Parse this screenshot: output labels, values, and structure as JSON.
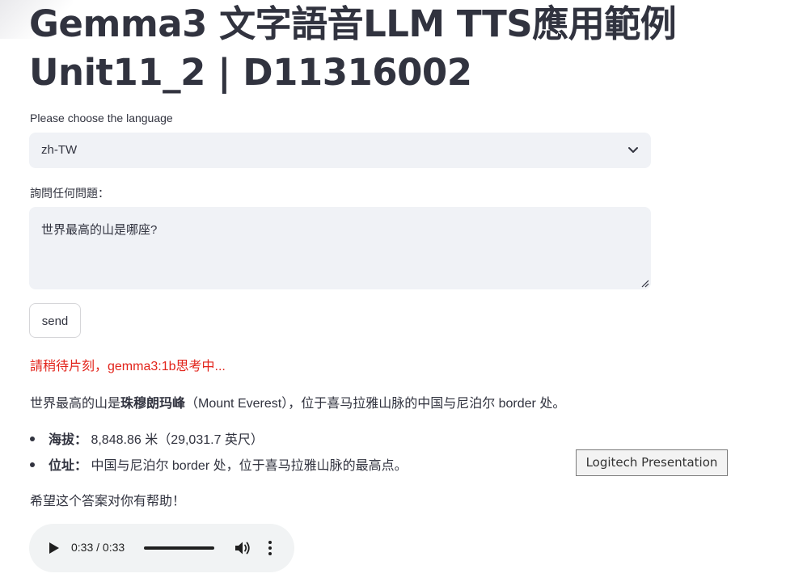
{
  "header": {
    "title_line1": "Gemma3 文字語音LLM TTS應用範例",
    "title_line2": "Unit11_2 | D11316002"
  },
  "language": {
    "label": "Please choose the language",
    "selected": "zh-TW"
  },
  "question": {
    "label": "詢問任何問題：",
    "value": "世界最高的山是哪座?"
  },
  "send_button": {
    "label": "send"
  },
  "status": {
    "text": "請稍待片刻，gemma3:1b思考中..."
  },
  "answer": {
    "intro_prefix": "世界最高的山是",
    "intro_bold": "珠穆朗玛峰",
    "intro_suffix": "（Mount Everest），位于喜马拉雅山脉的中国与尼泊尔 border 处。",
    "bullets": [
      {
        "label": "海拔：",
        "text": " 8,848.86 米（29,031.7 英尺）"
      },
      {
        "label": "位址：",
        "text": " 中国与尼泊尔 border 处，位于喜马拉雅山脉的最高点。"
      }
    ],
    "closing": "希望这个答案对你有帮助！"
  },
  "tooltip": {
    "text": "Logitech Presentation"
  },
  "audio": {
    "time": "0:33 / 0:33",
    "progress": 1.0,
    "icons": [
      "play-icon",
      "volume-icon",
      "more-vertical-icon"
    ]
  },
  "colors": {
    "status_red": "#e2231a",
    "input_bg": "#f0f2f6",
    "text": "#31333f"
  }
}
